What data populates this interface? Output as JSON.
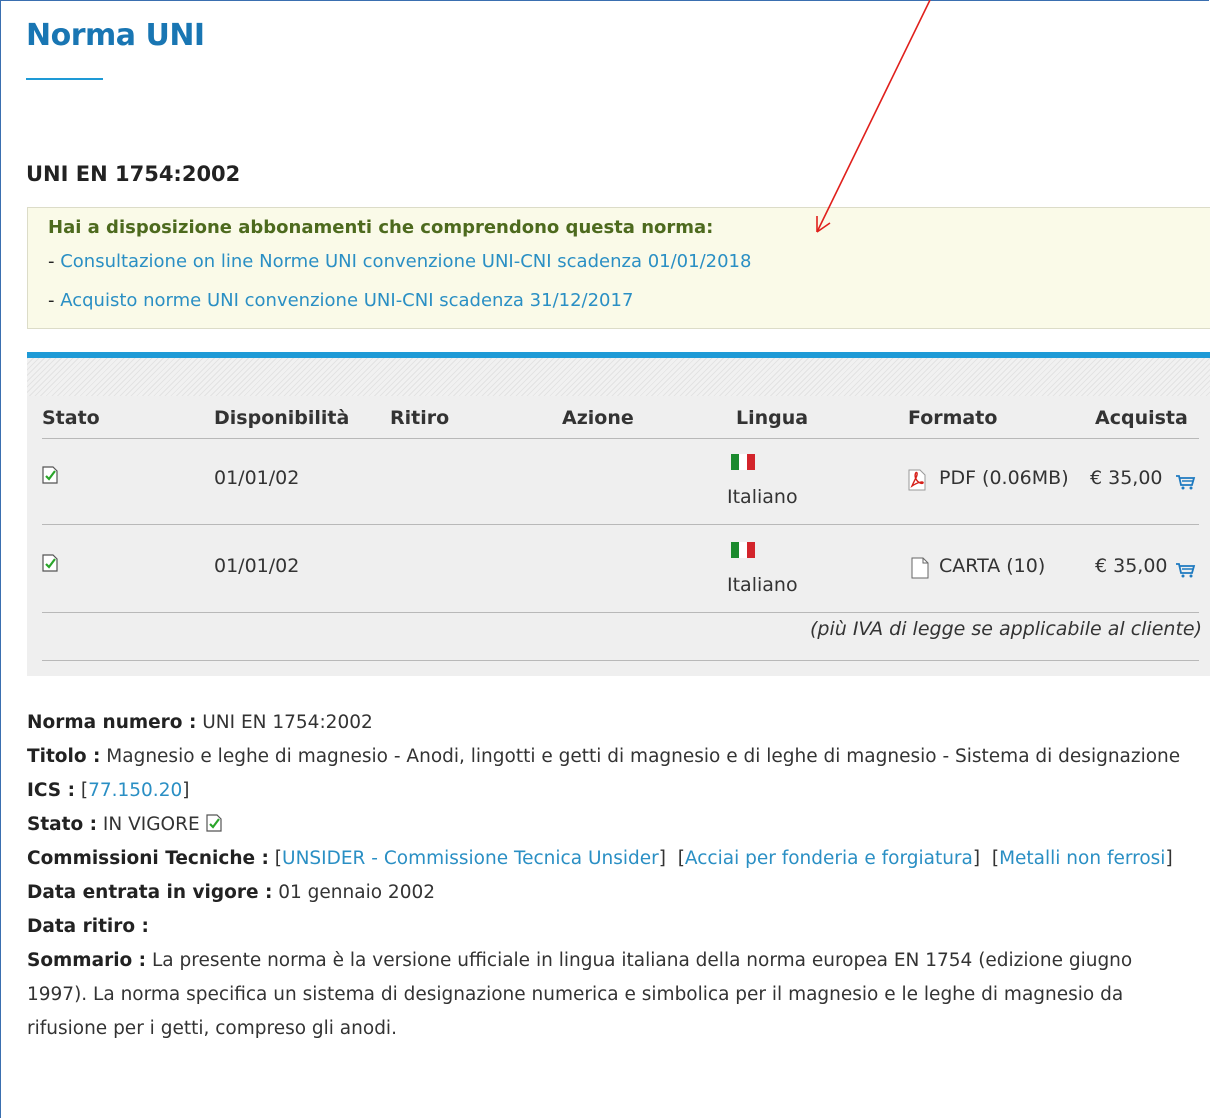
{
  "page": {
    "title": "Norma UNI",
    "norm_code": "UNI EN 1754:2002"
  },
  "subscriptions": {
    "heading": "Hai a disposizione abbonamenti che comprendono questa norma:",
    "items": [
      {
        "prefix": "- ",
        "label": "Consultazione on line Norme UNI convenzione UNI-CNI scadenza 01/01/2018"
      },
      {
        "prefix": "- ",
        "label": "Acquisto norme UNI convenzione UNI-CNI scadenza 31/12/2017"
      }
    ]
  },
  "table": {
    "headers": {
      "stato": "Stato",
      "disponibilita": "Disponibilità",
      "ritiro": "Ritiro",
      "azione": "Azione",
      "lingua": "Lingua",
      "formato": "Formato",
      "acquista": "Acquista"
    },
    "rows": [
      {
        "status_icon": "valid-check-icon",
        "disponibilita": "01/01/02",
        "ritiro": "",
        "azione": "",
        "lingua": "Italiano",
        "flag": "italy-flag-icon",
        "format_icon": "pdf-icon",
        "formato": "PDF (0.06MB)",
        "price": "€ 35,00",
        "cart_icon": "cart-icon"
      },
      {
        "status_icon": "valid-check-icon",
        "disponibilita": "01/01/02",
        "ritiro": "",
        "azione": "",
        "lingua": "Italiano",
        "flag": "italy-flag-icon",
        "format_icon": "paper-document-icon",
        "formato": "CARTA (10)",
        "price": "€ 35,00",
        "cart_icon": "cart-icon"
      }
    ],
    "note": "(più IVA di legge se applicabile al cliente)"
  },
  "details": {
    "numero": {
      "label": "Norma numero :",
      "value": " UNI EN 1754:2002"
    },
    "titolo": {
      "label": "Titolo :",
      "value": " Magnesio e leghe di magnesio - Anodi, lingotti e getti di magnesio e di leghe di magnesio - Sistema di designazione"
    },
    "ics": {
      "label": "ICS :",
      "pre": " [",
      "link": "77.150.20",
      "post": "]"
    },
    "stato": {
      "label": "Stato :",
      "value": " IN VIGORE"
    },
    "commissioni": {
      "label": "Commissioni Tecniche :",
      "links": [
        "UNSIDER - Commissione Tecnica Unsider",
        "Acciai per fonderia e forgiatura",
        "Metalli non ferrosi"
      ]
    },
    "data_vigore": {
      "label": "Data entrata in vigore :",
      "value": " 01 gennaio 2002"
    },
    "data_ritiro": {
      "label": "Data ritiro :",
      "value": ""
    },
    "sommario": {
      "label": "Sommario :",
      "value": " La presente norma è la versione ufficiale in lingua italiana della norma europea EN 1754 (edizione giugno 1997). La norma specifica un sistema di designazione numerica e simbolica per il magnesio e le leghe di magnesio da rifusione per i getti, compreso gli anodi."
    }
  },
  "colors": {
    "title_blue": "#1976b3",
    "link_blue": "#2a8fc4",
    "accent_bar": "#1e9ad6",
    "subs_heading_green": "#4d6a1e",
    "annotation_red": "#e0201c"
  }
}
